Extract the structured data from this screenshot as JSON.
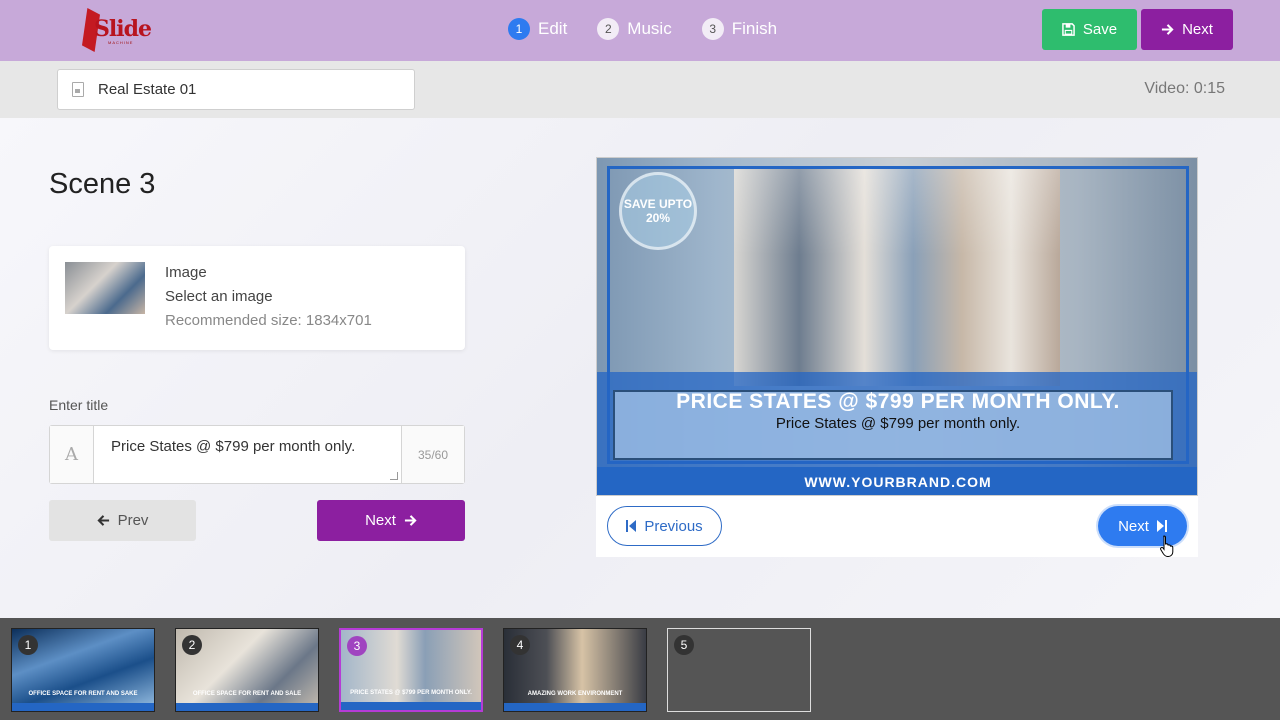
{
  "header": {
    "logo_text": "Slide",
    "logo_sub": "MACHINE",
    "steps": [
      {
        "num": "1",
        "label": "Edit"
      },
      {
        "num": "2",
        "label": "Music"
      },
      {
        "num": "3",
        "label": "Finish"
      }
    ],
    "save_label": "Save",
    "next_label": "Next"
  },
  "project": {
    "name": "Real Estate 01",
    "duration": "Video: 0:15"
  },
  "editor": {
    "scene_title": "Scene 3",
    "image_label": "Image",
    "image_select": "Select an image",
    "image_recommended": "Recommended size: 1834x701",
    "title_label": "Enter title",
    "title_value": "Price States @ $799 per month only.",
    "title_count": "35/60",
    "prev_label": "Prev",
    "next_label": "Next"
  },
  "preview": {
    "badge": "SAVE UPTO 20%",
    "caption_big": "PRICE STATES @ $799 PER MONTH ONLY.",
    "caption_small": "Price States @ $799 per month only.",
    "brand": "WWW.YOURBRAND.COM",
    "previous_label": "Previous",
    "next_label": "Next"
  },
  "filmstrip": {
    "slides": [
      {
        "num": "1",
        "caption": "OFFICE SPACE FOR RENT AND SAKE"
      },
      {
        "num": "2",
        "caption": "OFFICE SPACE FOR RENT AND SALE"
      },
      {
        "num": "3",
        "caption": "PRICE STATES @ $799 PER MONTH ONLY."
      },
      {
        "num": "4",
        "caption": "AMAZING WORK ENVIRONMENT"
      },
      {
        "num": "5",
        "caption": ""
      }
    ],
    "active_index": 2
  },
  "colors": {
    "topbar": "#c7a9d9",
    "save": "#2ebd6e",
    "purple": "#8c1fa0",
    "blue": "#2e7bf0"
  }
}
